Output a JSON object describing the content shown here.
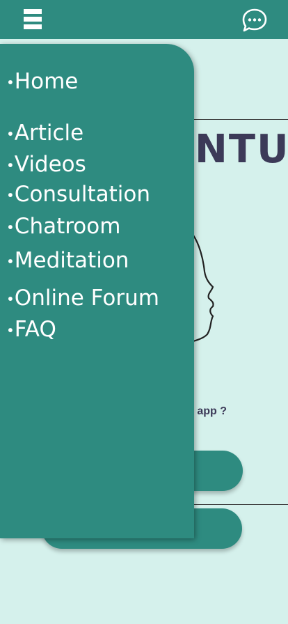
{
  "header": {
    "menu_icon": "hamburger-menu-icon",
    "chat_icon": "chat-bubble-dots-icon"
  },
  "background": {
    "brand_partial": "NTU",
    "question_partial": "s app ?"
  },
  "drawer": {
    "items": [
      {
        "label": "Home"
      },
      {
        "label": "Article"
      },
      {
        "label": "Videos"
      },
      {
        "label": "Consultation"
      },
      {
        "label": "Chatroom"
      },
      {
        "label": "Meditation"
      },
      {
        "label": "Online Forum"
      },
      {
        "label": "FAQ"
      }
    ]
  },
  "colors": {
    "primary": "#2e8b80",
    "background": "#d5f1ec",
    "text_dark": "#3c3a58",
    "text_light": "#ffffff"
  }
}
